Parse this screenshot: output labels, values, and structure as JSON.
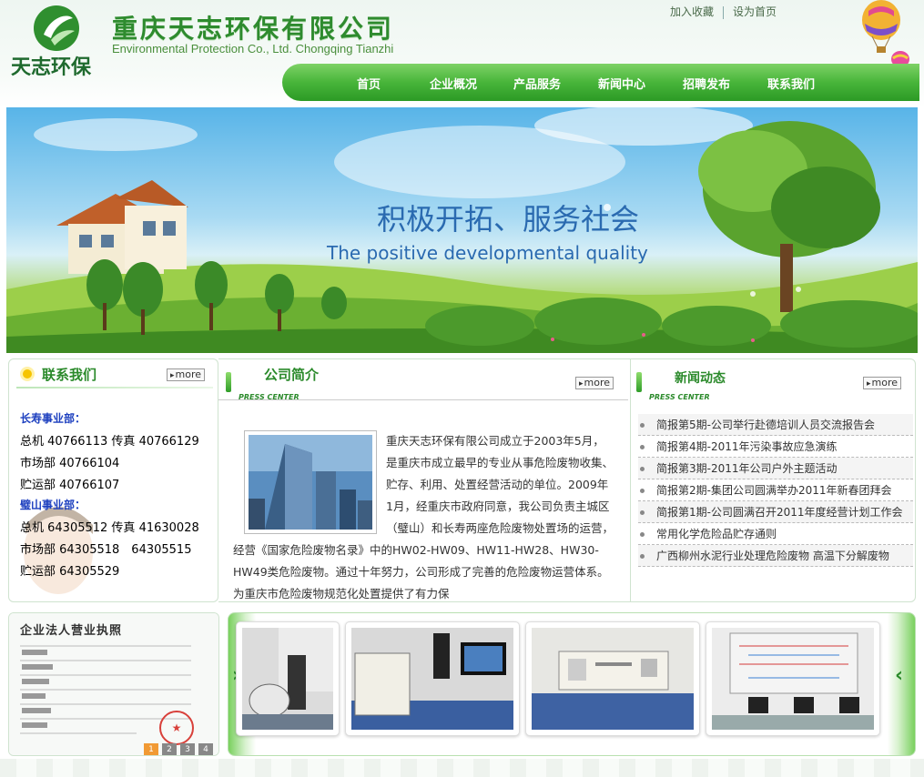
{
  "header": {
    "logo_text": "天志环保",
    "company_cn": "重庆天志环保有限公司",
    "company_en": "Environmental Protection Co., Ltd. Chongqing Tianzhi",
    "top_links": [
      "加入收藏",
      "设为首页"
    ]
  },
  "nav": [
    "首页",
    "企业概况",
    "产品服务",
    "新闻中心",
    "招聘发布",
    "联系我们"
  ],
  "banner": {
    "slogan_cn": "积极开拓、服务社会",
    "slogan_en": "The positive developmental quality"
  },
  "more_label": "more",
  "contact": {
    "title": "联系我们",
    "lines": [
      {
        "text": "长寿事业部：",
        "head": true
      },
      {
        "text": "总机 40766113 传真 40766129",
        "head": false
      },
      {
        "text": "市场部 40766104",
        "head": false
      },
      {
        "text": "贮运部 40766107",
        "head": false
      },
      {
        "text": "璧山事业部：",
        "head": true
      },
      {
        "text": "总机 64305512 传真 41630028",
        "head": false
      },
      {
        "text": "市场部 64305518　64305515",
        "head": false
      },
      {
        "text": "贮运部 64305529",
        "head": false
      }
    ]
  },
  "profile": {
    "title": "公司简介",
    "subtitle_en": "PRESS CENTER",
    "text": "重庆天志环保有限公司成立于2003年5月，是重庆市成立最早的专业从事危险废物收集、贮存、利用、处置经营活动的单位。2009年1月，经重庆市政府同意，我公司负责主城区（璧山）和长寿两座危险废物处置场的运营，经营《国家危险废物名录》中的HW02-HW09、HW11-HW28、HW30-HW49类危险废物。通过十年努力，公司形成了完善的危险废物运营体系。为重庆市危险废物规范化处置提供了有力保"
  },
  "news": {
    "title": "新闻动态",
    "subtitle_en": "PRESS CENTER",
    "items": [
      "简报第5期-公司举行赴德培训人员交流报告会",
      "简报第4期-2011年污染事故应急演练",
      "简报第3期-2011年公司户外主题活动",
      "简报第2期-集团公司圆满举办2011年新春团拜会",
      "简报第1期-公司圆满召开2011年度经营计划工作会",
      "常用化学危险品贮存通则",
      "广西柳州水泥行业处理危险废物 高温下分解废物"
    ]
  },
  "license": {
    "caption": "企业法人营业执照",
    "pages": [
      "1",
      "2",
      "3",
      "4"
    ],
    "active_page": "1"
  },
  "gallery": {
    "prev_icon": "arrow-left-icon",
    "next_icon": "arrow-right-icon",
    "photos": [
      "lab-equipment-photo",
      "analyzer-photo",
      "laboratory-bench-photo",
      "control-room-photo"
    ]
  },
  "colors": {
    "brand_green": "#2e8b2e",
    "nav_green": "#48b53a",
    "link_blue": "#1c3fbf",
    "pager_active": "#f19a34"
  }
}
